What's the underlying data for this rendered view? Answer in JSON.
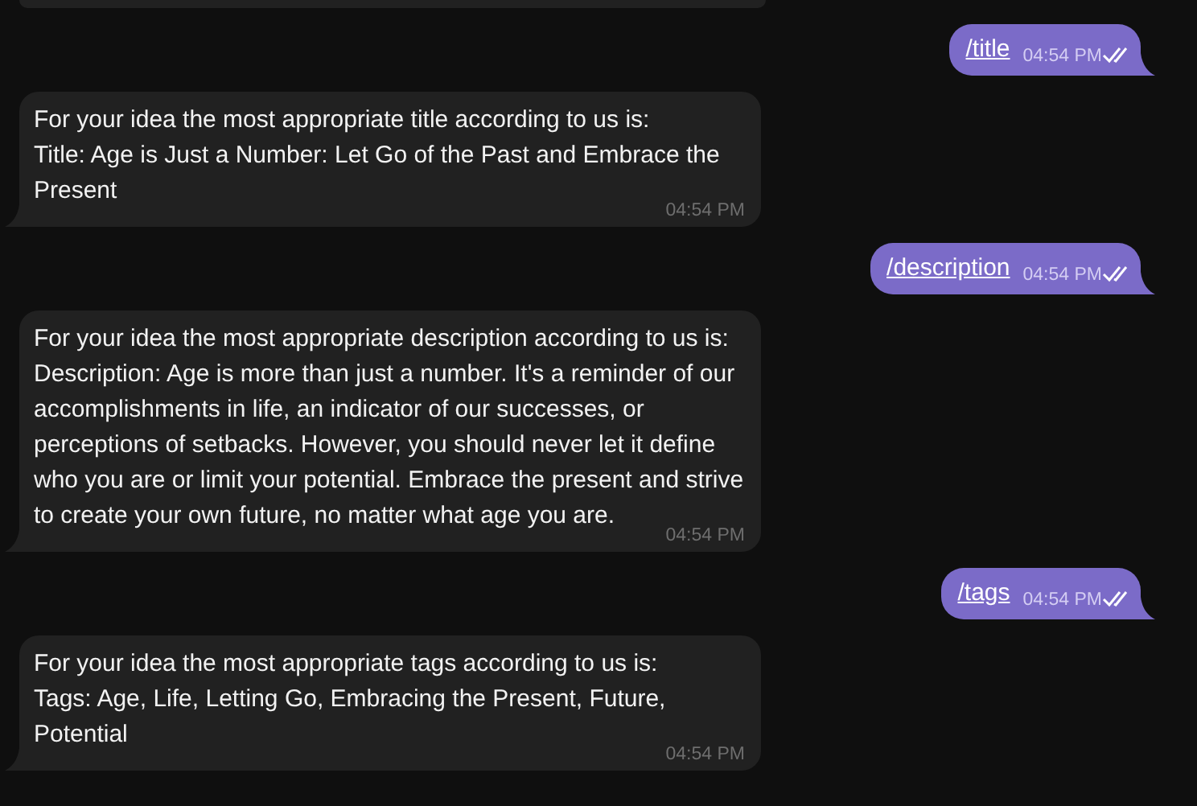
{
  "messages": [
    {
      "kind": "outgoing",
      "text": "/title",
      "time": "04:54 PM",
      "read": true
    },
    {
      "kind": "incoming",
      "text": "For your idea the most appropriate title according to us is:\nTitle: Age is Just a Number: Let Go of the Past and Embrace the Present",
      "time": "04:54 PM"
    },
    {
      "kind": "outgoing",
      "text": "/description",
      "time": "04:54 PM",
      "read": true
    },
    {
      "kind": "incoming",
      "text": "For your idea the most appropriate description according to us is:\nDescription: Age is more than just a number. It's a reminder of our accomplishments in life, an indicator of our successes, or perceptions of setbacks. However, you should never let it define who you are or limit your potential. Embrace the present and strive to create your own future, no matter what age you are.",
      "time": "04:54 PM"
    },
    {
      "kind": "outgoing",
      "text": "/tags",
      "time": "04:54 PM",
      "read": true
    },
    {
      "kind": "incoming",
      "text": "For your idea the most appropriate tags according to us is:\nTags: Age, Life, Letting Go, Embracing the Present, Future, Potential",
      "time": "04:54 PM"
    }
  ]
}
